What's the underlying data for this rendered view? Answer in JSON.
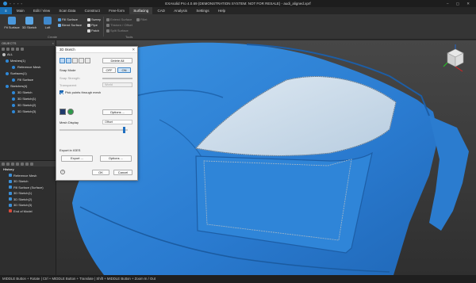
{
  "titlebar": {
    "title": "EXAsolid Pro 4.0.69 (DEMONSTRATION SYSTEM: NOT FOR RESALE) - audi_aligned.xprf",
    "window_controls": "– ▢ ✕"
  },
  "menubar": {
    "items": [
      "Main",
      "Edit / View",
      "Scan Data",
      "Construct",
      "Free-form",
      "Surfacing",
      "CAD",
      "Analysis",
      "Settings",
      "Help"
    ],
    "active": "Surfacing"
  },
  "ribbon": {
    "fit_surface": "Fit Surface",
    "sketch_3d": "3D Sketch",
    "loft": "Loft",
    "fill_surface": "Fill Surface",
    "blend_surface": "Blend Surface",
    "sweep": "Sweep",
    "pipe": "Pipe",
    "patch": "Patch",
    "extend_surface": "Extend Surface",
    "thicken_offset": "Thicken / Offset",
    "split_surface": "Split Surface",
    "fillet": "Fillet",
    "group_create": "Create",
    "group_tools": "Tools"
  },
  "objects": {
    "header": "OBJECTS",
    "items": [
      {
        "label": "ALL"
      },
      {
        "label": "Meshes(1)"
      },
      {
        "label": "Reference Mesh"
      },
      {
        "label": "Surfaces(1)"
      },
      {
        "label": "Fill Surface"
      },
      {
        "label": "Sketches(4)"
      },
      {
        "label": "3D Sketch"
      },
      {
        "label": "3D Sketch(1)"
      },
      {
        "label": "3D Sketch(2)"
      },
      {
        "label": "3D Sketch(3)"
      }
    ]
  },
  "history": {
    "header": "History",
    "items": [
      {
        "label": "Reference Mesh"
      },
      {
        "label": "3D Sketch"
      },
      {
        "label": "Fill Surface (Surface)"
      },
      {
        "label": "3D Sketch(1)"
      },
      {
        "label": "3D Sketch(2)"
      },
      {
        "label": "3D Sketch(3)"
      },
      {
        "label": "End of Model"
      }
    ]
  },
  "dialog": {
    "title": "3D Sketch",
    "delete_all": "Delete All",
    "snap_mode_label": "Snap Mode",
    "off_label": "OFF",
    "on_label": "ON",
    "snap_strength_label": "Snap Strength",
    "transparent_label": "Transparent",
    "transparent_value": "World",
    "pick_points_label": "Pick points through mesh",
    "options_label": "Options ...",
    "mesh_display_label": "Mesh Display",
    "mesh_display_value": "Offset",
    "export_label": "Export in IGES",
    "export_button": "Export ...",
    "options_button": "Options ...",
    "ok": "OK",
    "cancel": "Cancel",
    "help": "?"
  },
  "statusbar": {
    "text": "MIDDLE Button + Rotate | Ctrl + MIDDLE Button + Translate | Shift + MIDDLE Button + Zoom In / Out"
  },
  "colors": {
    "mesh_blue": "#2f86dd",
    "surface_fill": "#c9d9e8",
    "dialog_bg": "#f3f3f3",
    "app_bg": "#2d2d2d",
    "accent": "#1a6fb3"
  }
}
